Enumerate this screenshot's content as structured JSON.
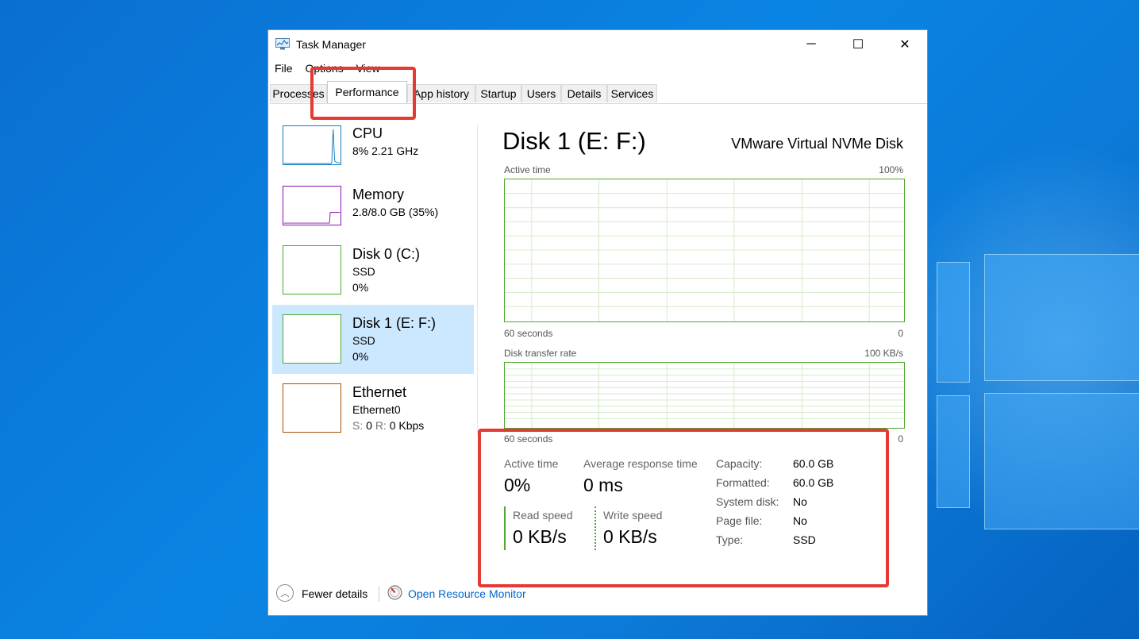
{
  "window": {
    "title": "Task Manager",
    "minimize_glyph": "─",
    "maximize_glyph": "☐",
    "close_glyph": "✕"
  },
  "menu": {
    "file": "File",
    "options": "Options",
    "view": "View"
  },
  "tabs": [
    "Processes",
    "Performance",
    "App history",
    "Startup",
    "Users",
    "Details",
    "Services"
  ],
  "active_tab": "Performance",
  "sidebar": {
    "cpu": {
      "name": "CPU",
      "line1": "8%  2.21 GHz"
    },
    "memory": {
      "name": "Memory",
      "line1": "2.8/8.0 GB (35%)"
    },
    "disk0": {
      "name": "Disk 0 (C:)",
      "line1": "SSD",
      "line2": "0%"
    },
    "disk1": {
      "name": "Disk 1 (E: F:)",
      "line1": "SSD",
      "line2": "0%"
    },
    "ethernet": {
      "name": "Ethernet",
      "line1": "Ethernet0",
      "s_label": "S:",
      "s_value": "0",
      "r_label": "R:",
      "r_value": "0 Kbps"
    }
  },
  "detail": {
    "title": "Disk 1 (E: F:)",
    "model": "VMware Virtual NVMe Disk",
    "graph1": {
      "label": "Active time",
      "max": "100%",
      "time": "60 seconds",
      "min": "0"
    },
    "graph2": {
      "label": "Disk transfer rate",
      "max": "100 KB/s",
      "time": "60 seconds",
      "min": "0"
    },
    "stats": {
      "active_time_label": "Active time",
      "active_time_value": "0%",
      "avg_resp_label": "Average response time",
      "avg_resp_value": "0 ms",
      "read_label": "Read speed",
      "read_value": "0 KB/s",
      "write_label": "Write speed",
      "write_value": "0 KB/s"
    },
    "props": [
      {
        "k": "Capacity:",
        "v": "60.0 GB"
      },
      {
        "k": "Formatted:",
        "v": "60.0 GB"
      },
      {
        "k": "System disk:",
        "v": "No"
      },
      {
        "k": "Page file:",
        "v": "No"
      },
      {
        "k": "Type:",
        "v": "SSD"
      }
    ]
  },
  "footer": {
    "fewer_details": "Fewer details",
    "resource_monitor": "Open Resource Monitor"
  },
  "colors": {
    "cpu": "#117dbb",
    "memory": "#8b12ae",
    "disk": "#4caa2e",
    "ethernet": "#a74f01",
    "highlight": "#e53935",
    "selected": "#cce8ff",
    "link": "#0066cc"
  }
}
